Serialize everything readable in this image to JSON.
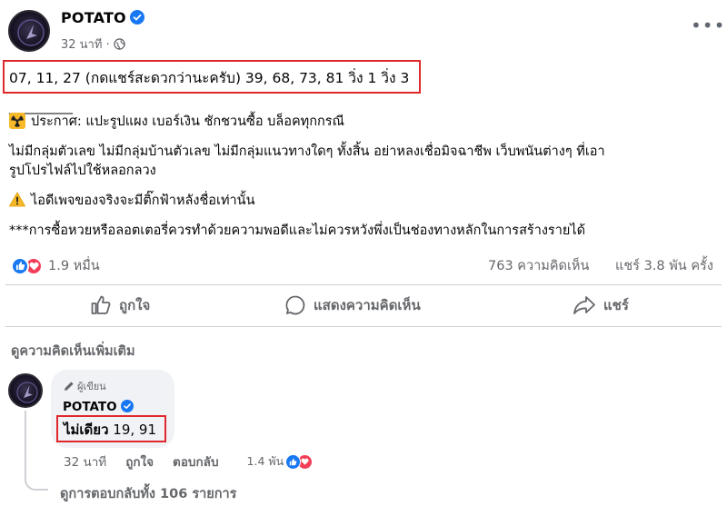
{
  "post": {
    "page_name": "POTATO",
    "time": "32 นาที ·",
    "numbers_line": "07, 11, 27 (กดแชร์สะดวกว่านะครับ) 39, 68, 73, 81 วิ่ง 1 วิ่ง 3",
    "divider": "__________",
    "announcement": "ประกาศ: แปะรูปแผง เบอร์เงิน ชักชวนซื้อ บล็อคทุกกรณี",
    "paragraph_line1": "ไม่มีกลุ่มตัวเลข ไม่มีกลุ่มบ้านตัวเลข ไม่มีกลุ่มแนวทางใดๆ ทั้งสิ้น อย่าหลงเชื่อมิจฉาชีพ เว็บพนันต่างๆ ที่เอา",
    "paragraph_line2": "รูปโปรไฟล์ไปใช้หลอกลวง",
    "warning": "ไอดีเพจของจริงจะมีติ๊กฟ้าหลังชื่อเท่านั้น",
    "disclaimer": "***การซื้อหวยหรือลอตเตอรี่ควรทำด้วยความพอดีและไม่ควรหวังพึ่งเป็นช่องทางหลักในการสร้างรายได้"
  },
  "stats": {
    "reactions": "1.9 หมื่น",
    "comments": "763 ความคิดเห็น",
    "shares": "แชร์ 3.8 พัน ครั้ง"
  },
  "actions": {
    "like": "ถูกใจ",
    "comment": "แสดงความคิดเห็น",
    "share": "แชร์"
  },
  "comments_section": {
    "see_more": "ดูความคิดเห็นเพิ่มเติม",
    "comment": {
      "badge": "ผู้เขียน",
      "author": "POTATO",
      "text_bold": "ไม่เดียว",
      "text_rest": " 19, 91",
      "time": "32 นาที",
      "like": "ถูกใจ",
      "reply": "ตอบกลับ",
      "reaction_count": "1.4 พัน"
    },
    "view_replies": "ดูการตอบกลับทั้ง 106 รายการ"
  },
  "colors": {
    "accent": "#1877f2",
    "love": "#f33e58",
    "highlight_box": "#e0272b",
    "muted_text": "#65676b"
  },
  "icons": [
    "verified-icon",
    "globe-icon",
    "more-icon",
    "radioactive-icon",
    "warning-icon",
    "like-icon",
    "love-icon",
    "comment-icon",
    "share-icon",
    "pencil-icon"
  ]
}
